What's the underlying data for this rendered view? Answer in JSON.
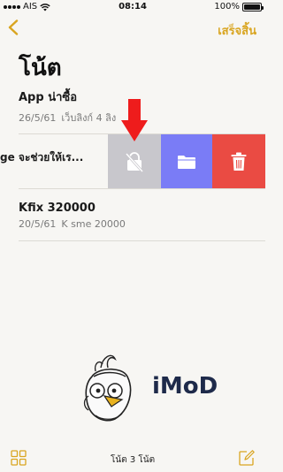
{
  "status_bar": {
    "carrier": "AIS",
    "time": "08:14",
    "battery_text": "100%",
    "battery_level": 1.0
  },
  "nav": {
    "back_icon": "chevron-left-icon",
    "done_label": "เสร็จสิ้น",
    "accent_color": "#d9a520"
  },
  "page": {
    "title": "โน้ต"
  },
  "notes": [
    {
      "title": "App น่าซื้อ",
      "date": "26/5/61",
      "preview": "เว็บลิงก์ 4 ลิง"
    },
    {
      "title": "ge จะช่วยให้เร..."
    },
    {
      "title": "Kfix 320000",
      "date": "20/5/61",
      "preview": "K sme 20000"
    }
  ],
  "swipe_actions": [
    {
      "name": "unlock",
      "icon": "lock-slash-icon",
      "color": "#c8c7cc"
    },
    {
      "name": "move",
      "icon": "folder-icon",
      "color": "#7a7cf6"
    },
    {
      "name": "delete",
      "icon": "trash-icon",
      "color": "#ea4b43"
    }
  ],
  "watermark": {
    "text": "iMoD"
  },
  "bottom_bar": {
    "grid_icon": "gallery-grid-icon",
    "count_text": "โน้ต 3 โน้ต",
    "compose_icon": "compose-icon"
  }
}
